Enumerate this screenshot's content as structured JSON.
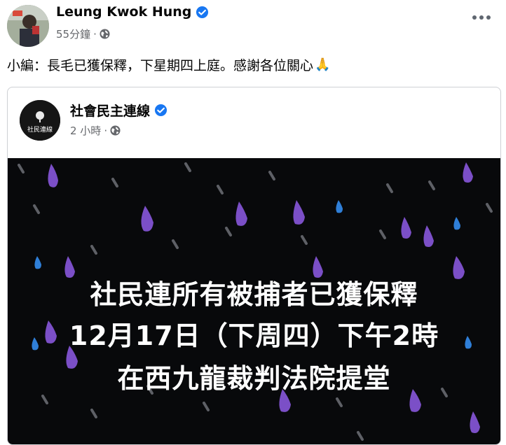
{
  "post": {
    "author": "Leung Kwok Hung",
    "time": "55分鐘",
    "separator": "·",
    "text": "小編：長毛已獲保釋，下星期四上庭。感謝各位關心",
    "emoji": "🙏"
  },
  "shared": {
    "page_name": "社會民主連線",
    "logo_text": "社民連線",
    "time": "2 小時",
    "separator": "·",
    "banner_lines": [
      "社民連所有被捕者已獲保釋",
      "12月17日（下周四）下午2時",
      "在西九龍裁判法院提堂"
    ]
  },
  "colors": {
    "verified": "#1877f2",
    "meta_text": "#65676b",
    "banner_bg": "#08090b",
    "drop_purple": "#7b4fc7",
    "drop_blue": "#2f7fd8",
    "drop_grey": "#5e6066"
  },
  "icons": {
    "verified": "verified-badge-icon",
    "audience": "globe-icon",
    "more": "more-options-icon",
    "emoji": "folded-hands-emoji"
  }
}
